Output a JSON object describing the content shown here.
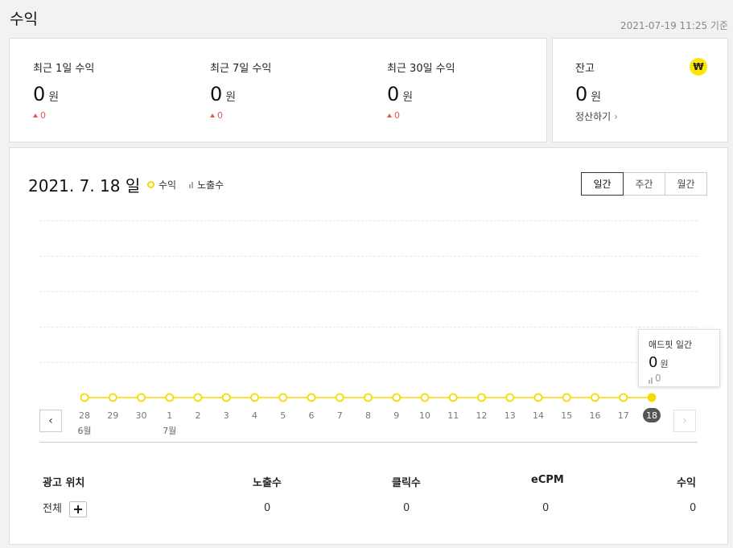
{
  "header": {
    "title": "수익",
    "timestamp": "2021-07-19 11:25 기준"
  },
  "revenue": {
    "currency_unit": "원",
    "stats": [
      {
        "label": "최근 1일 수익",
        "value": "0",
        "delta": "0"
      },
      {
        "label": "최근 7일 수익",
        "value": "0",
        "delta": "0"
      },
      {
        "label": "최근 30일 수익",
        "value": "0",
        "delta": "0"
      }
    ]
  },
  "balance": {
    "label": "잔고",
    "value": "0",
    "unit": "원",
    "settle_link": "정산하기",
    "icon": "won-icon",
    "icon_glyph": "₩"
  },
  "chart_header": {
    "date": "2021. 7. 18",
    "day": "일",
    "legend_revenue": "수익",
    "legend_impressions": "노출수",
    "tabs": [
      "일간",
      "주간",
      "월간"
    ],
    "active_tab": 0
  },
  "tooltip": {
    "title": "애드핏 일간",
    "value": "0",
    "unit": "원",
    "impressions": "0"
  },
  "chart_data": {
    "type": "line",
    "x": [
      "28",
      "29",
      "30",
      "1",
      "2",
      "3",
      "4",
      "5",
      "6",
      "7",
      "8",
      "9",
      "10",
      "11",
      "12",
      "13",
      "14",
      "15",
      "16",
      "17",
      "18"
    ],
    "month_labels": [
      {
        "index": 0,
        "label": "6월"
      },
      {
        "index": 3,
        "label": "7월"
      }
    ],
    "series": [
      {
        "name": "수익",
        "values": [
          0,
          0,
          0,
          0,
          0,
          0,
          0,
          0,
          0,
          0,
          0,
          0,
          0,
          0,
          0,
          0,
          0,
          0,
          0,
          0,
          0
        ]
      }
    ],
    "selected_index": 20,
    "color": "#f5dc00"
  },
  "table": {
    "headers": [
      "광고 위치",
      "노출수",
      "클릭수",
      "eCPM",
      "수익"
    ],
    "row": {
      "position": "전체",
      "impressions": "0",
      "clicks": "0",
      "ecpm": "0",
      "revenue": "0"
    }
  }
}
